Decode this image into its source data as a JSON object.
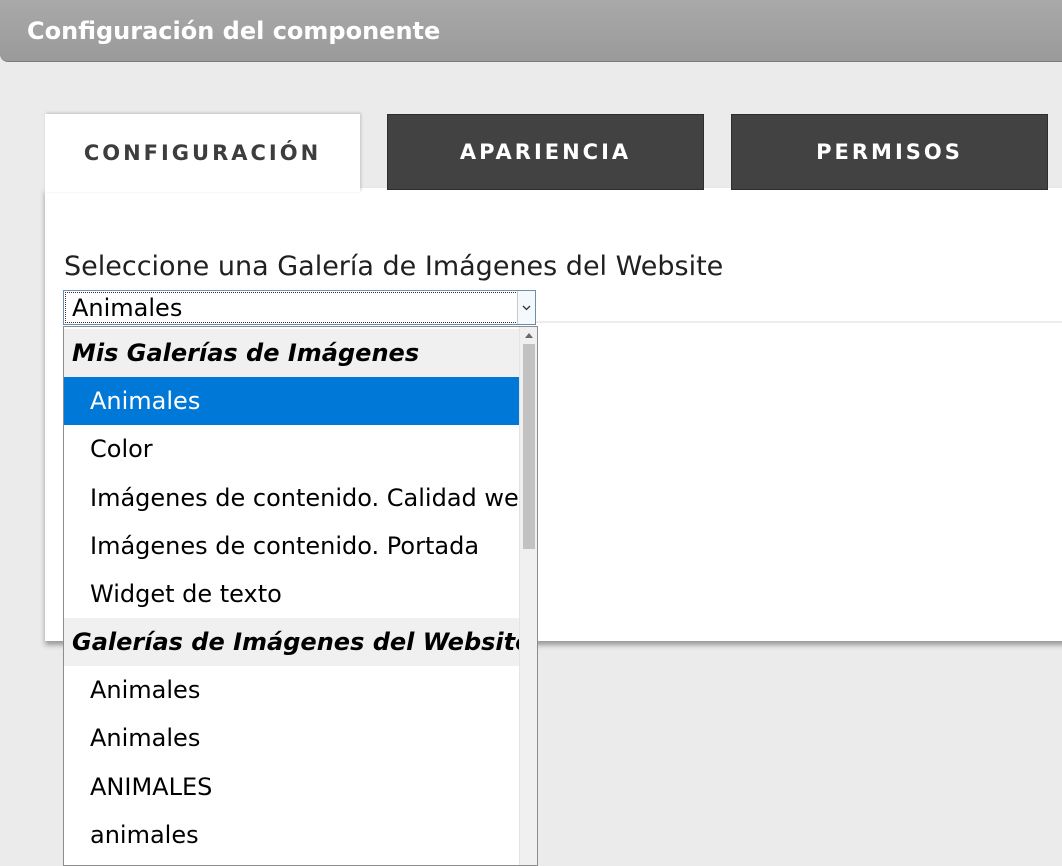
{
  "window": {
    "title": "Configuración del componente"
  },
  "tabs": [
    {
      "label": "CONFIGURACIÓN",
      "active": true
    },
    {
      "label": "APARIENCIA",
      "active": false
    },
    {
      "label": "PERMISOS",
      "active": false
    }
  ],
  "gallery_field": {
    "label": "Seleccione una Galería de Imágenes del Website",
    "selected_value": "Animales"
  },
  "dropdown": {
    "groups": [
      {
        "label": "Mis Galerías de Imágenes",
        "options": [
          "Animales",
          "Color",
          "Imágenes de contenido. Calidad web",
          "Imágenes de contenido. Portada",
          "Widget de texto"
        ]
      },
      {
        "label": "Galerías de Imágenes del Website",
        "options": [
          "Animales",
          "Animales",
          "ANIMALES",
          "animales"
        ]
      }
    ],
    "highlighted_option": "Animales"
  },
  "icons": {
    "select_arrow": "chevron-down-icon",
    "scroll_up": "scroll-up-arrow-icon"
  },
  "colors": {
    "highlight": "#0078d7",
    "tab_dark": "#424242",
    "titlebar": "#a3a3a3"
  }
}
